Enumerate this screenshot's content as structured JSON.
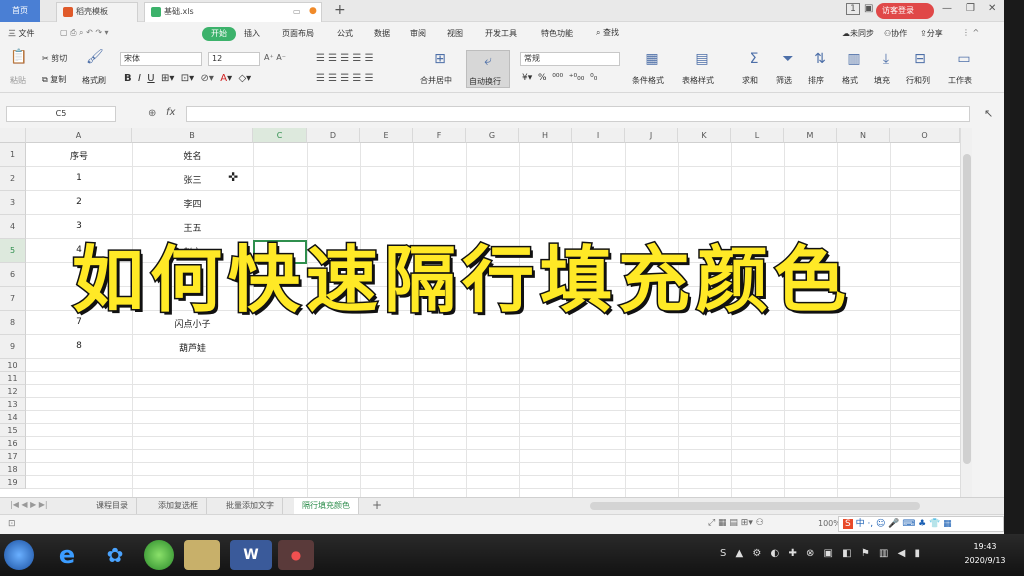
{
  "tabs": {
    "home": "首页",
    "template": "稻壳模板",
    "file": "基础.xls"
  },
  "title_actions": {
    "login": "访客登录"
  },
  "menu": {
    "file": "三 文件",
    "start": "开始",
    "items": [
      "插入",
      "页面布局",
      "公式",
      "数据",
      "审阅",
      "视图",
      "开发工具",
      "特色功能"
    ],
    "search": "查找",
    "sync": "未同步",
    "collab": "协作",
    "share": "分享"
  },
  "ribbon": {
    "paste": "粘贴",
    "cut": "剪切",
    "copy": "复制",
    "format_painter": "格式刷",
    "font_name": "宋体",
    "font_size": "12",
    "merge": "合并居中",
    "wrap": "自动换行",
    "number_format": "常规",
    "cond_format": "条件格式",
    "table_style": "表格样式",
    "sum": "求和",
    "filter": "筛选",
    "sort": "排序",
    "format": "格式",
    "fill": "填充",
    "rowcol": "行和列",
    "worksheet": "工作表"
  },
  "formula_bar": {
    "cell_ref": "C5",
    "fx": "fx",
    "content": ""
  },
  "columns": [
    "A",
    "B",
    "C",
    "D",
    "E",
    "F",
    "G",
    "H",
    "I",
    "J",
    "K",
    "L",
    "M",
    "N",
    "O"
  ],
  "rows": [
    "1",
    "2",
    "3",
    "4",
    "5",
    "6",
    "7",
    "8",
    "9",
    "10",
    "11",
    "12",
    "13",
    "14",
    "15",
    "16",
    "17",
    "18",
    "19"
  ],
  "cells": {
    "a1": "序号",
    "b1": "姓名",
    "a2": "1",
    "b2": "张三",
    "a3": "2",
    "b3": "李四",
    "a4": "3",
    "b4": "王五",
    "a5": "4",
    "b5": "赵六",
    "a8": "7",
    "b8": "闪点小子",
    "a9": "8",
    "b9": "葫芦娃"
  },
  "sheet_tabs": [
    "课程目录",
    "添加复选框",
    "批量添加文字",
    "隔行填充颜色"
  ],
  "active_sheet_index": 3,
  "status": {
    "zoom": "100%"
  },
  "overlay_title": "如何快速隔行填充颜色",
  "clock": {
    "time": "19:43",
    "date": "2020/9/13"
  },
  "colors": {
    "accent_green": "#3cb26b",
    "overlay_yellow": "#ffe926",
    "home_tab_blue": "#4a7fd4"
  }
}
